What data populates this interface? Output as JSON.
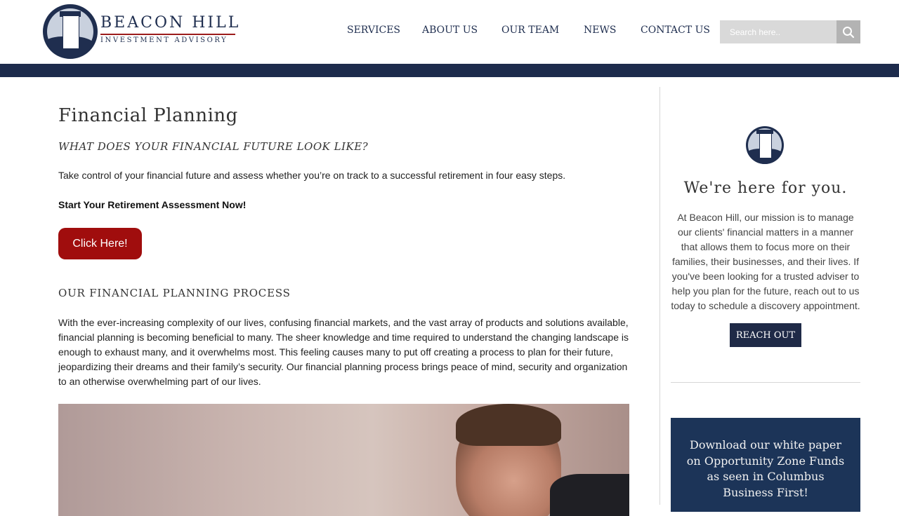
{
  "brand": {
    "name": "BEACON HILL",
    "tagline": "INVESTMENT ADVISORY"
  },
  "nav": {
    "items": [
      {
        "label": "SERVICES"
      },
      {
        "label": "ABOUT US"
      },
      {
        "label": "OUR TEAM"
      },
      {
        "label": "NEWS"
      },
      {
        "label": "CONTACT US"
      }
    ]
  },
  "search": {
    "placeholder": "Search here..",
    "value": ""
  },
  "main": {
    "title": "Financial Planning",
    "subtitle": "WHAT DOES YOUR FINANCIAL FUTURE LOOK LIKE?",
    "intro": "Take control of your financial future and assess whether you’re on track to a successful retirement in four easy steps.",
    "cta_text": "Start Your Retirement Assessment Now!",
    "cta_button": "Click Here!",
    "process_heading": "OUR FINANCIAL PLANNING PROCESS",
    "process_body": "With the ever-increasing complexity of our lives, confusing financial markets, and the vast array of products and solutions available, financial planning is becoming beneficial to many. The sheer knowledge and time required to understand the changing landscape is enough to exhaust many, and it overwhelms most. This feeling causes many to put off creating a process to plan for their future, jeopardizing their dreams and their family’s security. Our financial planning process brings peace of mind, security and organization to an otherwise overwhelming part of our lives."
  },
  "sidebar": {
    "heading": "We're here for you.",
    "text": "At Beacon Hill, our mission is to manage our clients' financial matters in a manner that allows them to focus more on their families, their businesses, and their lives. If you've been looking for a trusted adviser to help you plan for the future, reach out to us today to schedule a discovery appointment.",
    "button": "REACH OUT",
    "promo": "Download our white paper on Opportunity Zone Funds as seen in Columbus Business First!"
  },
  "colors": {
    "navy": "#1d2b4c",
    "cta_red": "#a00d0d",
    "promo_blue": "#1c3458",
    "search_bg": "#d9d9d9"
  },
  "icons": [
    "lighthouse-logo-icon",
    "search-icon"
  ]
}
